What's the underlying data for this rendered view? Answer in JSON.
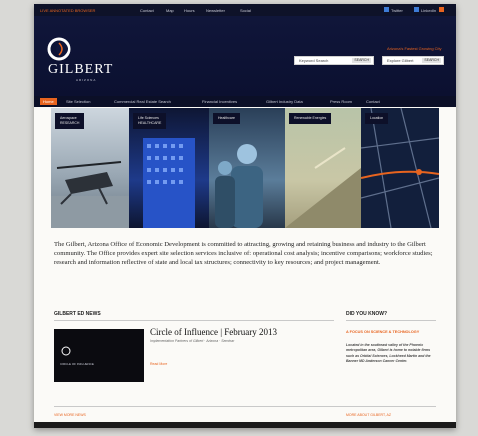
{
  "topbar": {
    "left_link": "LIVE ANNOTATED BROWSER",
    "middle_links": [
      "Contact",
      "Map",
      "Hours",
      "Newsletter",
      "Social"
    ],
    "right_links": [
      "Twitter",
      "LinkedIn",
      "RSS"
    ]
  },
  "logo": {
    "name": "GILBERT",
    "sub": "ARIZONA"
  },
  "header": {
    "tagline": "Arizona's Fastest Growing City",
    "search_left": {
      "placeholder": "Keyword Search",
      "button": "SEARCH"
    },
    "search_right": {
      "placeholder": "Explore Gilbert",
      "button": "SEARCH"
    }
  },
  "nav": {
    "items": [
      "Home",
      "Site Selection",
      "Commercial Real Estate Search",
      "Financial Incentives",
      "Gilbert Industry Data",
      "Press Room",
      "Contact"
    ]
  },
  "hero": {
    "panels": [
      {
        "label": "Aerospace\nRESEARCH"
      },
      {
        "label": "Life Sciences\nHEALTHCARE"
      },
      {
        "label": "Healthcare"
      },
      {
        "label": "Renewable Energies"
      },
      {
        "label": "Location"
      }
    ]
  },
  "intro": {
    "text": "The Gilbert, Arizona Office of Economic Development is committed to attracting, growing and retaining business and industry to the Gilbert community. The Office provides expert site selection services inclusive of: operational cost analysis; incentive comparisons; workforce studies; research and information reflective of state and local tax structures; connectivity to key resources; and project management."
  },
  "news": {
    "heading": "GILBERT ED NEWS",
    "title": "Circle of Influence | February 2013",
    "meta": "Implementation Partners of Gilbert · Arizona · Seminar",
    "more": "Read More",
    "thumb_label": "CIRCLE OF INFLUENCE"
  },
  "dyk": {
    "heading": "DID YOU KNOW?",
    "subhead": "A FOCUS ON SCIENCE & TECHNOLOGY",
    "body": "Located in the southeast valley of the Phoenix metropolitan area, Gilbert is home to notable firms such as Orbital Sciences, Lockheed Martin and the Banner MD Anderson Cancer Center."
  },
  "footer": {
    "left": "VIEW MORE NEWS",
    "right": "MORE ABOUT GILBERT, AZ"
  },
  "colors": {
    "navy": "#0e1229",
    "accent": "#e8641f"
  }
}
